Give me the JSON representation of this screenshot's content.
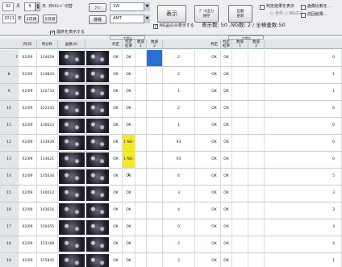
{
  "toolbar": {
    "month_value": "02",
    "month_unit": "月",
    "day_value": "9",
    "day_unit": "日",
    "mode_label": "日ｾﾙﾓｰﾄﾞ切替",
    "year_value": "2011",
    "year_unit": "年",
    "from_day": "1日目",
    "to_day": "1日目",
    "line_label": "ﾗｲﾝ",
    "line_value": "1W",
    "machine_label": "機種",
    "machine_value": "AMT",
    "show_label": "表示",
    "csv_label": "ﾃﾞｰﾀ出力\n保存",
    "auto_label": "自動\n更新",
    "ng_only_label": "NG品のみ表示する",
    "check1_label": "判定結果を表示",
    "check2_label": "画像比較を...",
    "check3_label": "登録設定",
    "check4_label": "前回結果...",
    "count_text": "表示数: 50 ,NG数: 2 / 全検査数:50",
    "radio_label": "○ 全件 ○ NGのみ"
  },
  "grid": {
    "group_left": "工程①",
    "group_right": "工程②",
    "auto_scroll_label": "最終を表示する",
    "headers": [
      "月/日",
      "時分秒",
      "画像(X)",
      "画像(Y)",
      "判定",
      "判定\n結果",
      "数値\n1",
      "数値\n2",
      "判定",
      "判定\n結果",
      "数値\n1",
      "数値\n2"
    ],
    "rows": [
      {
        "no": "7",
        "date": "02/09",
        "time": "114659",
        "j1": "OK",
        "r1": "OK",
        "n1": "",
        "v2": "2",
        "j2": "OK",
        "r2": "OK",
        "last": "0",
        "selected": true,
        "mark": "blue"
      },
      {
        "no": "8",
        "date": "02/09",
        "time": "114843",
        "j1": "OK",
        "r1": "OK",
        "n1": "",
        "v2": "2",
        "j2": "OK",
        "r2": "OK",
        "last": "1"
      },
      {
        "no": "9",
        "date": "02/09",
        "time": "120733",
        "j1": "OK",
        "r1": "OK",
        "n1": "",
        "v2": "1",
        "j2": "OK",
        "r2": "OK",
        "last": "1"
      },
      {
        "no": "10",
        "date": "02/09",
        "time": "122243",
        "j1": "OK",
        "r1": "OK",
        "n1": "",
        "v2": "2",
        "j2": "OK",
        "r2": "OK",
        "last": "0"
      },
      {
        "no": "11",
        "date": "02/09",
        "time": "130623",
        "j1": "OK",
        "r1": "OK",
        "n1": "",
        "v2": "1",
        "j2": "OK",
        "r2": "OK",
        "last": "0"
      },
      {
        "no": "12",
        "date": "02/09",
        "time": "133930",
        "j1": "OK",
        "r1": "1 NG-1",
        "n1": "",
        "v2": "93",
        "j2": "OK",
        "r2": "OK",
        "last": "0",
        "ng": true
      },
      {
        "no": "13",
        "date": "02/09",
        "time": "133621",
        "j1": "OK",
        "r1": "1 NG-1",
        "n1": "",
        "v2": "93",
        "j2": "OK",
        "r2": "OK",
        "last": "0",
        "ng": true
      },
      {
        "no": "14",
        "date": "02/09",
        "time": "135034",
        "j1": "OK",
        "r1": "OK",
        "n1": "",
        "v2": "4",
        "j2": "OK",
        "r2": "OK",
        "last": "5"
      },
      {
        "no": "15",
        "date": "02/09",
        "time": "140012",
        "j1": "OK",
        "r1": "OK",
        "n1": "",
        "v2": "3",
        "j2": "OK",
        "r2": "OK",
        "last": "3"
      },
      {
        "no": "16",
        "date": "02/09",
        "time": "143616",
        "j1": "OK",
        "r1": "OK",
        "n1": "",
        "v2": "4",
        "j2": "OK",
        "r2": "OK",
        "last": "3"
      },
      {
        "no": "17",
        "date": "02/09",
        "time": "150455",
        "j1": "OK",
        "r1": "OK",
        "n1": "",
        "v2": "0",
        "j2": "OK",
        "r2": "OK",
        "last": "3"
      },
      {
        "no": "18",
        "date": "02/09",
        "time": "153189",
        "j1": "OK",
        "r1": "OK",
        "n1": "",
        "v2": "2",
        "j2": "OK",
        "r2": "OK",
        "last": "4"
      },
      {
        "no": "19",
        "date": "02/09",
        "time": "155845",
        "j1": "OK",
        "r1": "OK",
        "n1": "",
        "v2": "2",
        "j2": "OK",
        "r2": "OK",
        "last": "1"
      }
    ]
  },
  "colors": {
    "ng_highlight": "#f5ea2a",
    "selected_marker": "#2a6fd6"
  }
}
